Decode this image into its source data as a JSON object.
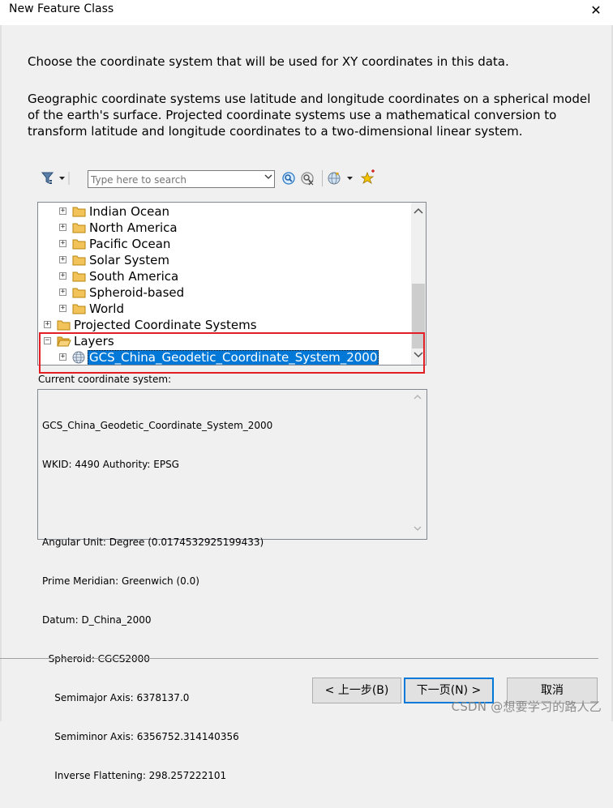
{
  "window": {
    "title": "New Feature Class",
    "close_glyph": "✕"
  },
  "intro": "Choose the coordinate system that will be used for XY coordinates in this data.",
  "description": "Geographic coordinate systems use latitude and longitude coordinates on a spherical model of the earth's surface. Projected coordinate systems use a mathematical conversion to transform latitude and longitude coordinates to a two-dimensional linear system.",
  "toolbar": {
    "filter_icon": "filter-icon",
    "search": {
      "value": "",
      "placeholder": "Type here to search"
    },
    "search_button_icon": "search-icon",
    "clear_search_icon": "clear-search-icon",
    "globe_icon": "globe-add-icon",
    "favorite_icon": "favorite-star-icon"
  },
  "tree": {
    "items": [
      {
        "label": "Indian Ocean",
        "icon": "folder-icon",
        "expander": "+"
      },
      {
        "label": "North America",
        "icon": "folder-icon",
        "expander": "+"
      },
      {
        "label": "Pacific Ocean",
        "icon": "folder-icon",
        "expander": "+"
      },
      {
        "label": "Solar System",
        "icon": "folder-icon",
        "expander": "+"
      },
      {
        "label": "South America",
        "icon": "folder-icon",
        "expander": "+"
      },
      {
        "label": "Spheroid-based",
        "icon": "folder-icon",
        "expander": "+"
      },
      {
        "label": "World",
        "icon": "folder-icon",
        "expander": "+"
      },
      {
        "label": "Projected Coordinate Systems",
        "icon": "folder-icon",
        "expander": "+"
      },
      {
        "label": "Layers",
        "icon": "folder-open-icon",
        "expander": "−"
      },
      {
        "label": "GCS_China_Geodetic_Coordinate_System_2000",
        "icon": "globe-icon",
        "expander": "+",
        "selected": true
      }
    ]
  },
  "current": {
    "label": "Current coordinate system:",
    "lines": [
      "GCS_China_Geodetic_Coordinate_System_2000",
      "WKID: 4490 Authority: EPSG",
      "",
      "Angular Unit: Degree (0.0174532925199433)",
      "Prime Meridian: Greenwich (0.0)",
      "Datum: D_China_2000",
      "  Spheroid: CGCS2000",
      "    Semimajor Axis: 6378137.0",
      "    Semiminor Axis: 6356752.314140356",
      "    Inverse Flattening: 298.257222101"
    ]
  },
  "buttons": {
    "back": "< 上一步(B)",
    "next": "下一页(N) >",
    "cancel": "取消"
  },
  "watermark": "CSDN @想要学习的路人乙",
  "colors": {
    "selection": "#0078d7",
    "highlight_box": "#e31e24",
    "folder": "#f2c35b"
  }
}
